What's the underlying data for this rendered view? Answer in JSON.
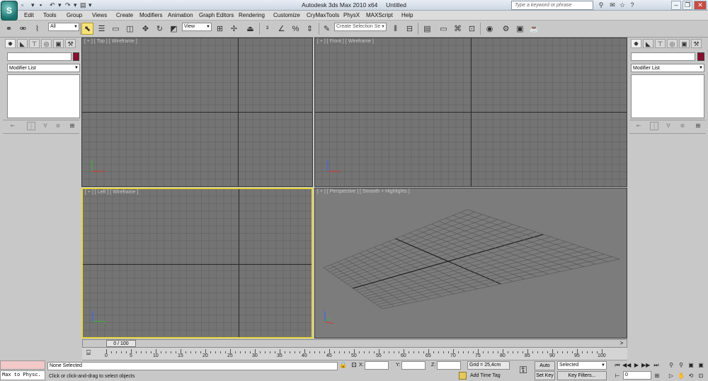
{
  "titlebar": {
    "app_title": "Autodesk 3ds Max 2010 x64",
    "doc_title": "Untitled",
    "search_placeholder": "Type a keyword or phrase",
    "logo_letter": "S"
  },
  "menu": [
    "Edit",
    "Tools",
    "Group",
    "Views",
    "Create",
    "Modifiers",
    "Animation",
    "Graph Editors",
    "Rendering",
    "Customize",
    "CryMaxTools",
    "PhysX",
    "MAXScript",
    "Help"
  ],
  "toolbar": {
    "selection_filter": "All",
    "reference_coord": "View",
    "named_selection_placeholder": "Create Selection Se"
  },
  "left_panel": {
    "modifier_list": "Modifier List"
  },
  "right_panel": {
    "modifier_list": "Modifier List"
  },
  "viewports": {
    "top": "[ + ] [ Top ] [ Wireframe ]",
    "front": "[ + ] [ Front ] [ Wireframe ]",
    "left": "[ + ] [ Left ] [ Wireframe ]",
    "perspective": "[ + ] [ Perspective ] [ Smooth + Highlights ]"
  },
  "timeline": {
    "position": "0 / 100",
    "ticks": [
      "0",
      "5",
      "10",
      "15",
      "20",
      "25",
      "30",
      "35",
      "40",
      "45",
      "50",
      "55",
      "60",
      "65",
      "70",
      "75",
      "80",
      "85",
      "90",
      "95",
      "100"
    ]
  },
  "status": {
    "maxscript_listener": "Max to Physc.",
    "selection": "None Selected",
    "prompt": "Click or click-and-drag to select objects",
    "x_label": "X:",
    "y_label": "Y:",
    "z_label": "Z:",
    "grid": "Grid = 25,4cm",
    "add_time_tag": "Add Time Tag",
    "auto_key": "Auto Key",
    "set_key": "Set Key",
    "key_mode": "Selected",
    "key_filters": "Key Filters...",
    "frame": "0"
  },
  "colors": {
    "active_viewport": "#e6d53a",
    "object_color": "#8a0f2e"
  }
}
